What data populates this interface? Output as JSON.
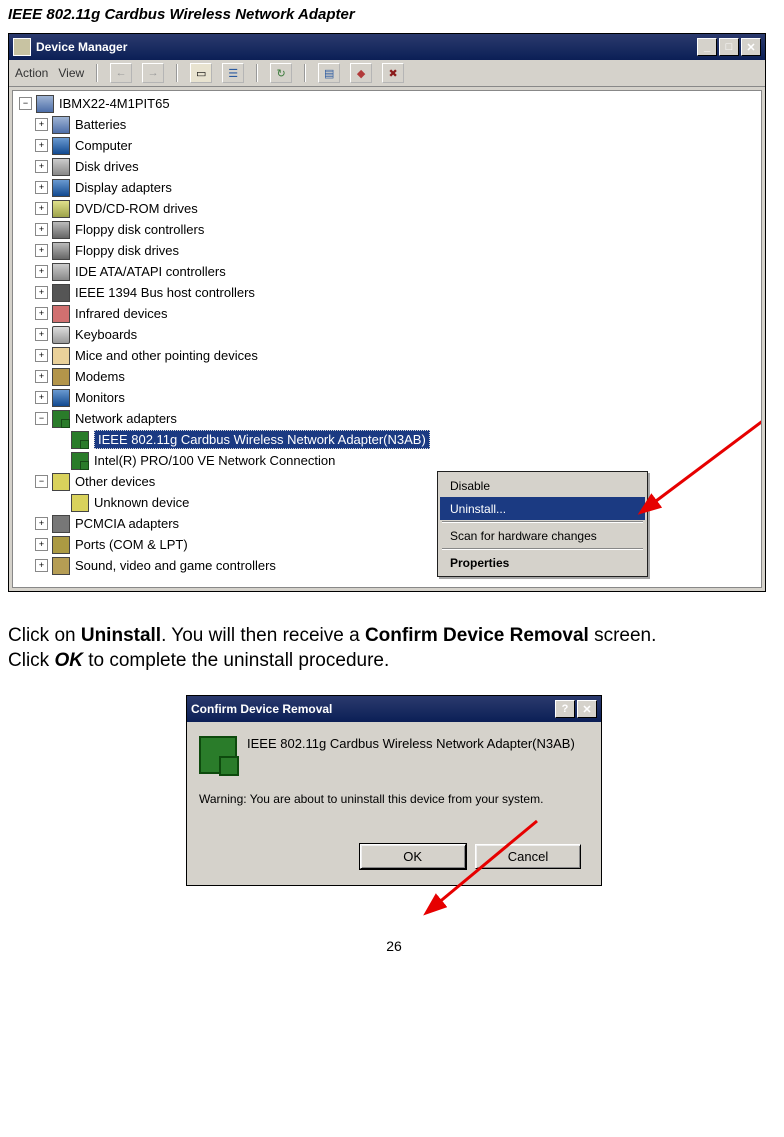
{
  "document": {
    "header": "IEEE 802.11g Cardbus Wireless Network Adapter",
    "page_number": "26"
  },
  "instruction": {
    "pre1": "Click on ",
    "bold1": "Uninstall",
    "mid1": ". You will then receive a ",
    "bold2": "Confirm Device Removal",
    "post1": " screen.",
    "line2_pre": "Click ",
    "line2_ok": "OK",
    "line2_post": " to complete the uninstall procedure."
  },
  "dm": {
    "title": "Device Manager",
    "menu_action": "Action",
    "menu_view": "View",
    "root": "IBMX22-4M1PIT65",
    "items": [
      "Batteries",
      "Computer",
      "Disk drives",
      "Display adapters",
      "DVD/CD-ROM drives",
      "Floppy disk controllers",
      "Floppy disk drives",
      "IDE ATA/ATAPI controllers",
      "IEEE 1394 Bus host controllers",
      "Infrared devices",
      "Keyboards",
      "Mice and other pointing devices",
      "Modems",
      "Monitors",
      "Network adapters"
    ],
    "net_sel": "IEEE 802.11g Cardbus Wireless Network Adapter(N3AB)",
    "net_other": "Intel(R) PRO/100 VE Network Connection",
    "other_hdr": "Other devices",
    "other_unknown": "Unknown device",
    "tail": [
      "PCMCIA adapters",
      "Ports (COM & LPT)",
      "Sound, video and game controllers"
    ],
    "ctx": {
      "disable": "Disable",
      "uninstall": "Uninstall...",
      "scan": "Scan for hardware changes",
      "properties": "Properties"
    }
  },
  "dialog": {
    "title": "Confirm Device Removal",
    "device": "IEEE 802.11g Cardbus Wireless Network Adapter(N3AB)",
    "warning": "Warning: You are about to uninstall this device from your system.",
    "ok": "OK",
    "cancel": "Cancel"
  }
}
